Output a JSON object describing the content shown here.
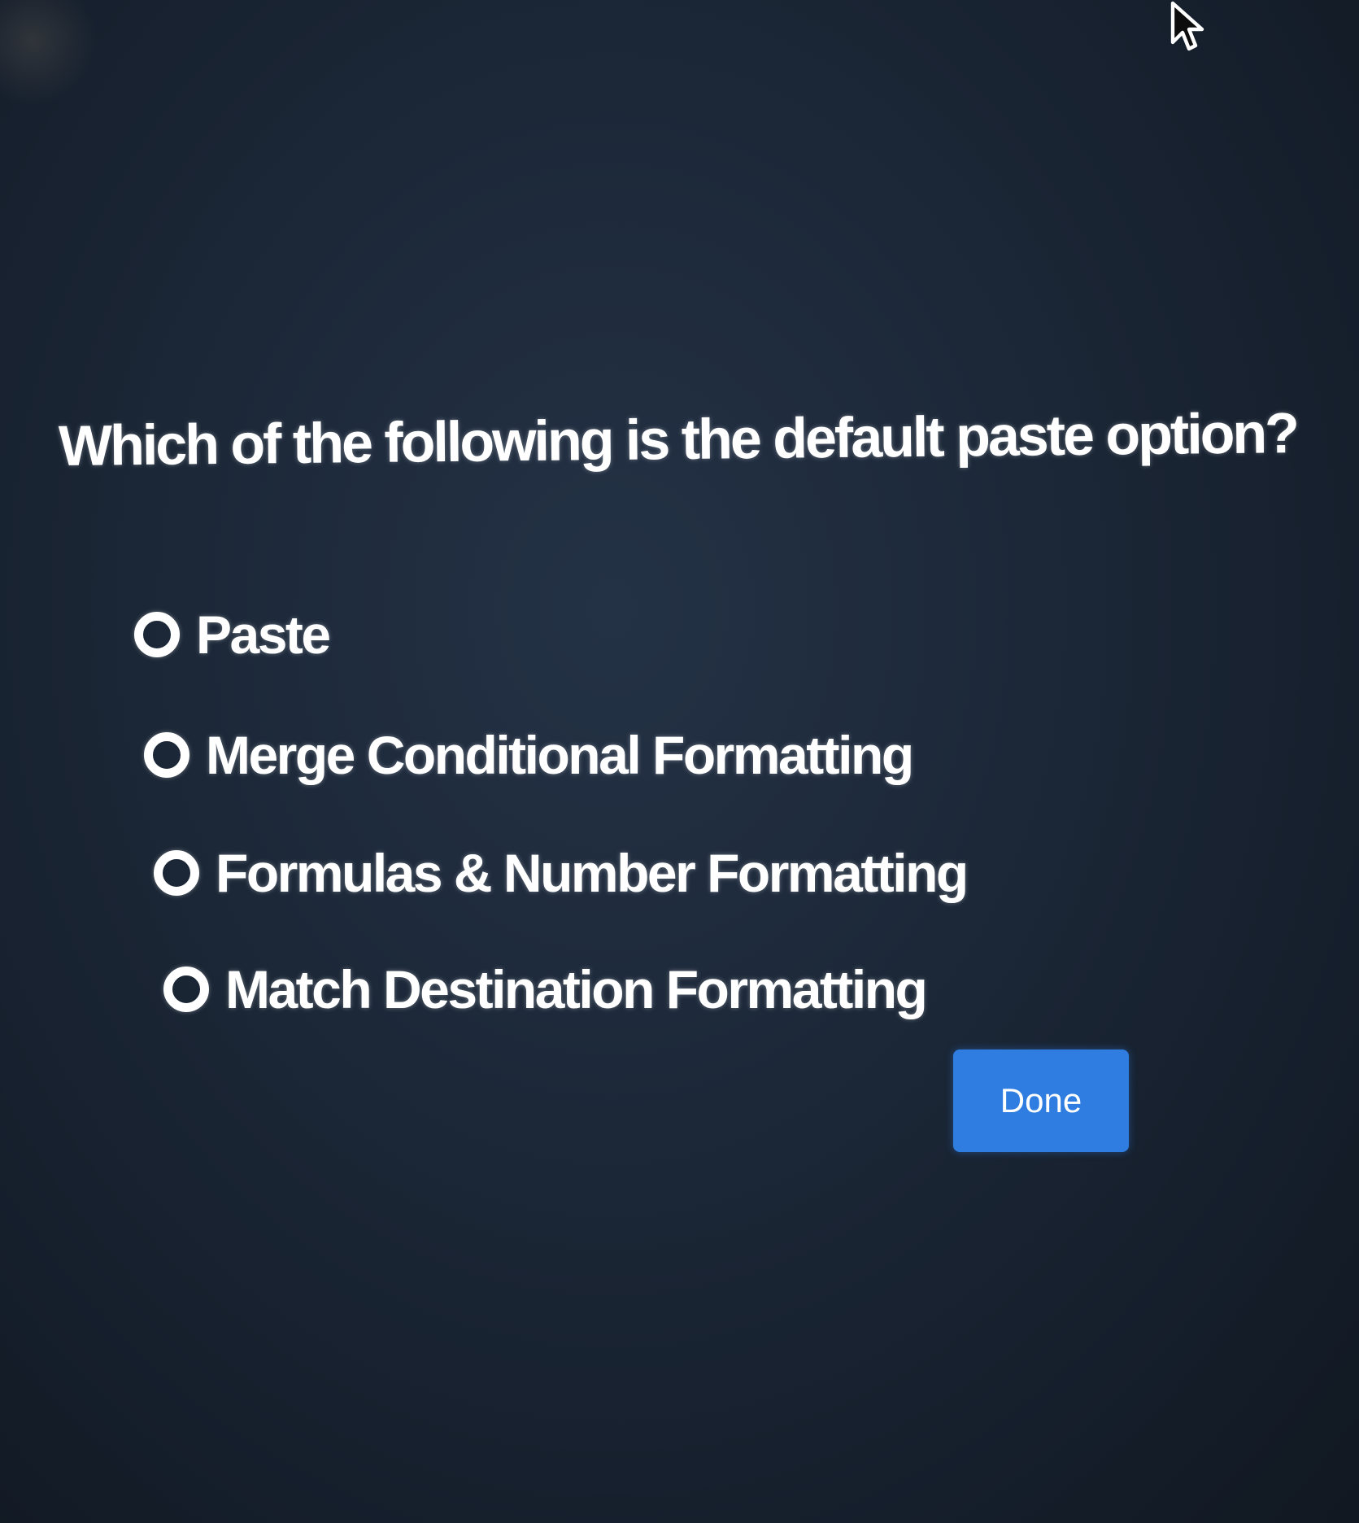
{
  "quiz": {
    "question": "Which of the following is the default paste option?",
    "options": [
      {
        "label": "Paste",
        "selected": false
      },
      {
        "label": "Merge Conditional Formatting",
        "selected": false
      },
      {
        "label": "Formulas & Number Formatting",
        "selected": false
      },
      {
        "label": "Match Destination Formatting",
        "selected": false
      }
    ],
    "done_label": "Done"
  },
  "icons": {
    "cursor": "mouse-pointer-icon",
    "radio": "radio-button-unselected-icon"
  },
  "colors": {
    "background": "#1c2838",
    "text": "#ffffff",
    "button": "#2f7de1"
  }
}
